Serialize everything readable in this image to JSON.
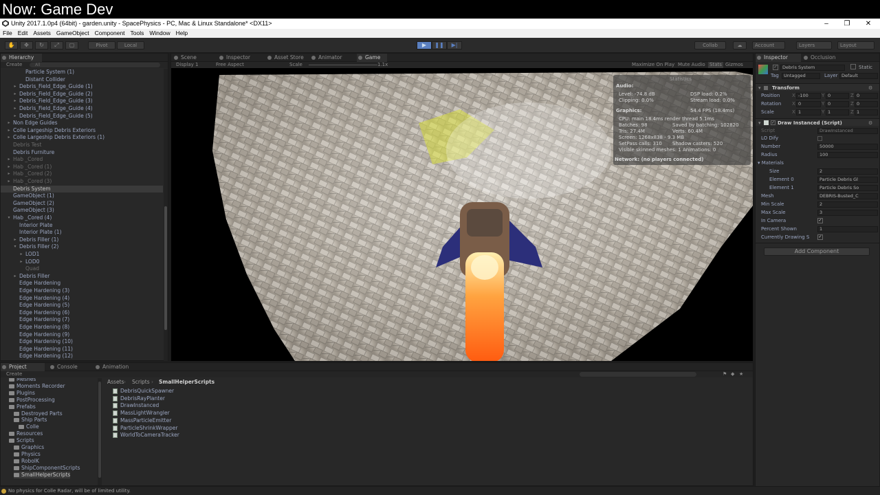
{
  "banner": "Now: Game Dev",
  "window": {
    "title": "Unity 2017.1.0p4 (64bit) - garden.unity - SpacePhysics - PC, Mac & Linux Standalone* <DX11>",
    "minimize": "–",
    "restore": "❐",
    "close": "✕"
  },
  "menu": [
    "File",
    "Edit",
    "Assets",
    "GameObject",
    "Component",
    "Tools",
    "Window",
    "Help"
  ],
  "toolbar": {
    "pivot": "Pivot",
    "local": "Local",
    "collab": "Collab",
    "account": "Account",
    "layers": "Layers",
    "layout": "Layout"
  },
  "hierarchy": {
    "tab": "Hierarchy",
    "create": "Create",
    "search": "All",
    "items": [
      {
        "label": "Particle System (1)",
        "indent": 4,
        "arrow": "",
        "style": ""
      },
      {
        "label": "Distant Collider",
        "indent": 4,
        "arrow": "",
        "style": ""
      },
      {
        "label": "Debris_Field_Edge_Guide (1)",
        "indent": 3,
        "arrow": "▸",
        "style": ""
      },
      {
        "label": "Debris_Field_Edge_Guide (2)",
        "indent": 3,
        "arrow": "▸",
        "style": ""
      },
      {
        "label": "Debris_Field_Edge_Guide (3)",
        "indent": 3,
        "arrow": "▸",
        "style": ""
      },
      {
        "label": "Debris_Field_Edge_Guide (4)",
        "indent": 3,
        "arrow": "▸",
        "style": ""
      },
      {
        "label": "Debris_Field_Edge_Guide (5)",
        "indent": 3,
        "arrow": "▸",
        "style": ""
      },
      {
        "label": "Non Edge Guides",
        "indent": 2,
        "arrow": "▸",
        "style": ""
      },
      {
        "label": "Colle Largeship Debris Exteriors",
        "indent": 2,
        "arrow": "▸",
        "style": ""
      },
      {
        "label": "Colle Largeship Debris Exteriors (1)",
        "indent": 2,
        "arrow": "▸",
        "style": ""
      },
      {
        "label": "Debris Test",
        "indent": 2,
        "arrow": "",
        "style": "grey"
      },
      {
        "label": "Debris Furniture",
        "indent": 2,
        "arrow": "",
        "style": ""
      },
      {
        "label": "Hab _Cored",
        "indent": 2,
        "arrow": "▸",
        "style": "grey"
      },
      {
        "label": "Hab _Cored (1)",
        "indent": 2,
        "arrow": "▸",
        "style": "grey"
      },
      {
        "label": "Hab _Cored (2)",
        "indent": 2,
        "arrow": "▸",
        "style": "grey"
      },
      {
        "label": "Hab _Cored (3)",
        "indent": 2,
        "arrow": "▸",
        "style": "grey"
      },
      {
        "label": "Debris System",
        "indent": 2,
        "arrow": "",
        "style": "sel"
      },
      {
        "label": "GameObject (1)",
        "indent": 2,
        "arrow": "",
        "style": ""
      },
      {
        "label": "GameObject (2)",
        "indent": 2,
        "arrow": "",
        "style": ""
      },
      {
        "label": "GameObject (3)",
        "indent": 2,
        "arrow": "",
        "style": ""
      },
      {
        "label": "Hab _Cored (4)",
        "indent": 2,
        "arrow": "▾",
        "style": ""
      },
      {
        "label": "Interior Plate",
        "indent": 3,
        "arrow": "",
        "style": ""
      },
      {
        "label": "Interior Plate (1)",
        "indent": 3,
        "arrow": "",
        "style": ""
      },
      {
        "label": "Debris Filler (1)",
        "indent": 3,
        "arrow": "▸",
        "style": ""
      },
      {
        "label": "Debris Filler (2)",
        "indent": 3,
        "arrow": "▾",
        "style": ""
      },
      {
        "label": "LOD1",
        "indent": 4,
        "arrow": "▸",
        "style": ""
      },
      {
        "label": "LOD0",
        "indent": 4,
        "arrow": "▸",
        "style": ""
      },
      {
        "label": "Quad",
        "indent": 4,
        "arrow": "",
        "style": "grey"
      },
      {
        "label": "Debris Filler",
        "indent": 3,
        "arrow": "▸",
        "style": ""
      },
      {
        "label": "Edge Hardening",
        "indent": 3,
        "arrow": "",
        "style": ""
      },
      {
        "label": "Edge Hardening (3)",
        "indent": 3,
        "arrow": "",
        "style": ""
      },
      {
        "label": "Edge Hardening (4)",
        "indent": 3,
        "arrow": "",
        "style": ""
      },
      {
        "label": "Edge Hardening (5)",
        "indent": 3,
        "arrow": "",
        "style": ""
      },
      {
        "label": "Edge Hardening (6)",
        "indent": 3,
        "arrow": "",
        "style": ""
      },
      {
        "label": "Edge Hardening (7)",
        "indent": 3,
        "arrow": "",
        "style": ""
      },
      {
        "label": "Edge Hardening (8)",
        "indent": 3,
        "arrow": "",
        "style": ""
      },
      {
        "label": "Edge Hardening (9)",
        "indent": 3,
        "arrow": "",
        "style": ""
      },
      {
        "label": "Edge Hardening (10)",
        "indent": 3,
        "arrow": "",
        "style": ""
      },
      {
        "label": "Edge Hardening (11)",
        "indent": 3,
        "arrow": "",
        "style": ""
      },
      {
        "label": "Edge Hardening (12)",
        "indent": 3,
        "arrow": "",
        "style": ""
      }
    ]
  },
  "center_tabs": [
    "Scene",
    "Inspector",
    "Asset Store",
    "Animator",
    "Game"
  ],
  "game": {
    "display": "Display 1",
    "aspect": "Free Aspect",
    "scale_label": "Scale",
    "scale_value": "1.1x",
    "maximize": "Maximize On Play",
    "mute": "Mute Audio",
    "stats": "Stats",
    "gizmos": "Gizmos"
  },
  "stats_overlay": {
    "header": "Statistics",
    "audio_title": "Audio:",
    "level": "Level: -74.8 dB",
    "dsp": "DSP load: 0.2%",
    "clipping": "Clipping: 0.0%",
    "stream": "Stream load: 0.0%",
    "graphics_title": "Graphics:",
    "fps": "54.4 FPS (18.4ms)",
    "cpu": "CPU: main 18.4ms  render thread 5.1ms",
    "batches": "Batches: 98",
    "saved": "Saved by batching: 102820",
    "tris": "Tris: 27.4M",
    "verts": "Verts: 60.4M",
    "screen": "Screen: 1268x838 - 9.3 MB",
    "setpass": "SetPass calls: 310",
    "shadow": "Shadow casters: 520",
    "skinned": "Visible skinned meshes: 1  Animations: 0",
    "network": "Network: (no players connected)"
  },
  "inspector": {
    "tab": "Inspector",
    "tab2": "Occlusion",
    "object_name": "Debris System",
    "static": "Static",
    "tag_label": "Tag",
    "tag_value": "Untagged",
    "layer_label": "Layer",
    "layer_value": "Default",
    "transform": "Transform",
    "position": {
      "label": "Position",
      "x": "-100",
      "y": "0",
      "z": "0"
    },
    "rotation": {
      "label": "Rotation",
      "x": "0",
      "y": "0",
      "z": "0"
    },
    "scale": {
      "label": "Scale",
      "x": "1",
      "y": "1",
      "z": "1"
    },
    "component": "Draw Instanced (Script)",
    "script_label": "Script",
    "script_value": "DrawInstanced",
    "lo_dify": "LO Dify",
    "number_label": "Number",
    "number_value": "50000",
    "radius_label": "Radius",
    "radius_value": "100",
    "materials": "Materials",
    "size_label": "Size",
    "size_value": "2",
    "element0_label": "Element 0",
    "element0_value": "Particle Debris Gl",
    "element1_label": "Element 1",
    "element1_value": "Particle Debris So",
    "mesh_label": "Mesh",
    "mesh_value": "DEBRIS-Busted_C",
    "minscale_label": "Min Scale",
    "minscale_value": "2",
    "maxscale_label": "Max Scale",
    "maxscale_value": "3",
    "incamera_label": "In Camera",
    "percent_label": "Percent Shown",
    "percent_value": "1",
    "drawing_label": "Currently Drawing S",
    "add_component": "Add Component"
  },
  "project": {
    "tabs": [
      "Project",
      "Console",
      "Animation"
    ],
    "create": "Create",
    "breadcrumb": [
      "Assets",
      "Scripts",
      "SmallHelperScripts"
    ],
    "folders": [
      {
        "label": "Meshes",
        "indent": 2
      },
      {
        "label": "Moments Recorder",
        "indent": 2
      },
      {
        "label": "Plugins",
        "indent": 2
      },
      {
        "label": "PostProcessing",
        "indent": 2
      },
      {
        "label": "Prefabs",
        "indent": 2
      },
      {
        "label": "Destroyed Parts",
        "indent": 3
      },
      {
        "label": "Ship Parts",
        "indent": 3
      },
      {
        "label": "Colle",
        "indent": 4
      },
      {
        "label": "Resources",
        "indent": 2
      },
      {
        "label": "Scripts",
        "indent": 2
      },
      {
        "label": "Graphics",
        "indent": 3
      },
      {
        "label": "Physics",
        "indent": 3
      },
      {
        "label": "RoboIK",
        "indent": 3
      },
      {
        "label": "ShipComponentScripts",
        "indent": 3
      },
      {
        "label": "SmallHelperScripts",
        "indent": 3
      }
    ],
    "assets": [
      "DebrisQuickSpawner",
      "DebrisRayPlanter",
      "DrawInstanced",
      "MassLightWrangler",
      "MassParticleEmitter",
      "ParticleShrinkWrapper",
      "WorldToCameraTracker"
    ]
  },
  "status": "No physics for Colle Radar, will be of limited utility."
}
